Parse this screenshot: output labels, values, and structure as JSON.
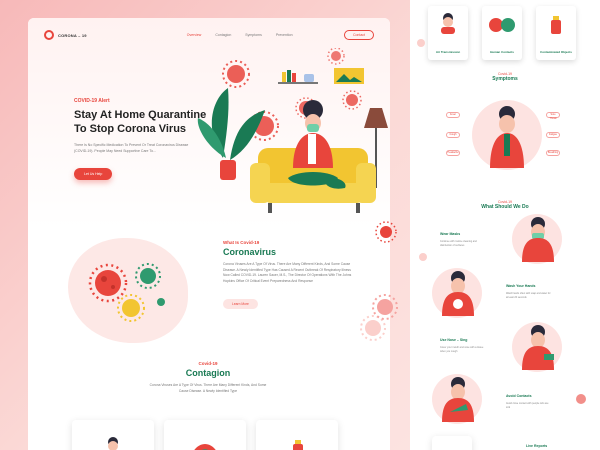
{
  "nav": {
    "logo_text": "CORONA – 19",
    "links": [
      "Overview",
      "Contagion",
      "Symptoms",
      "Prevention"
    ],
    "contact_label": "Contact"
  },
  "hero": {
    "kicker": "COVID-19 Alert",
    "title_line1": "Stay At Home Quarantine",
    "title_line2": "To Stop Corona Virus",
    "description": "There Is No Specific Medication To Prevent Or Treat Coronavirus Disease (COVID-19). People May Need Supportive Care To...",
    "cta_label": "Let Us Help"
  },
  "about": {
    "kicker": "What Is Covid-19",
    "title": "Coronavirus",
    "description": "Corona Viruses Are A Type Of Virus. There Are Many Different Kinds, And Some Cause Disease. A Newly Identified Type Has Caused A Recent Outbreak Of Respiratory Illness Now Called COVID-19. Lauren Sauer, M.S., The Director Of Operations With The Johns Hopkins Office Of Critical Event Preparedness And Response",
    "button_label": "Learn More"
  },
  "contagion": {
    "kicker": "Covid-19",
    "title": "Contagion",
    "description": "Corona Viruses Are A Type Of Virus. There Are Many Different Kinds, And Some Cause Disease. A Newly Identified Type"
  },
  "right": {
    "top_cards": [
      "Air Transmission",
      "Human Contacts",
      "Contaminated Objects"
    ],
    "symptoms_kicker": "Covid-19",
    "symptoms_title": "Symptoms",
    "symptom_pills": [
      "Fever",
      "Cough",
      "Headache",
      "Sore Throat",
      "Fatigue",
      "Breathing"
    ],
    "do_kicker": "Covid-19",
    "do_title": "What Should We Do",
    "actions": [
      {
        "title": "Wear Masks",
        "desc": "Continue with routine cleaning and disinfection of surfaces"
      },
      {
        "title": "Wash Your Hands",
        "desc": "Wash hands often with soap and water for at least 20 seconds"
      },
      {
        "title": "Use Nose – Sing",
        "desc": "Cover your mouth and nose with a tissue when you cough"
      },
      {
        "title": "Avoid Contacts",
        "desc": "Avoid close contact with people who are sick"
      }
    ],
    "live_reports": "Live Reports"
  },
  "colors": {
    "accent": "#e8453c",
    "green": "#1a7a54",
    "yellow": "#f2c531"
  }
}
